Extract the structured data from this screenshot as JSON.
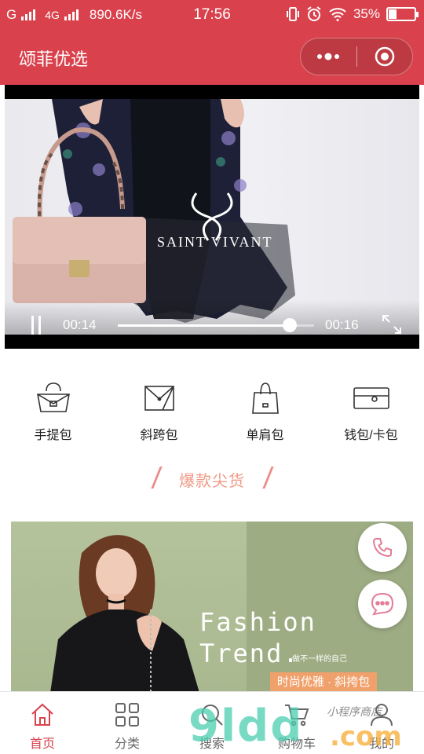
{
  "status_bar": {
    "left_text": "G",
    "network": "4G",
    "speed": "890.6K/s",
    "time": "17:56",
    "battery": "35%",
    "battery_level": 0.35
  },
  "nav": {
    "title": "颂菲优选",
    "more_icon": "more-dots-icon",
    "close_icon": "target-circle-icon"
  },
  "video": {
    "brand_text": "SAINT VIVANT",
    "current_time": "00:14",
    "duration": "00:16",
    "progress": 0.875
  },
  "categories": [
    {
      "label": "手提包",
      "icon": "handbag-icon"
    },
    {
      "label": "斜跨包",
      "icon": "crossbody-bag-icon"
    },
    {
      "label": "单肩包",
      "icon": "shoulder-bag-icon"
    },
    {
      "label": "钱包/卡包",
      "icon": "wallet-icon"
    }
  ],
  "section": {
    "hot_title": "爆款尖货"
  },
  "banner": {
    "line1": "Fashion",
    "line2": "Trend.",
    "subtitle": "做不一样的自己",
    "tag": "时尚优雅 · 斜挎包"
  },
  "tabs": [
    {
      "label": "首页",
      "icon": "home-icon",
      "active": true
    },
    {
      "label": "分类",
      "icon": "grid-icon",
      "active": false
    },
    {
      "label": "搜索",
      "icon": "search-icon",
      "active": false
    },
    {
      "label": "购物车",
      "icon": "cart-icon",
      "active": false
    },
    {
      "label": "我的",
      "icon": "user-icon",
      "active": false
    }
  ],
  "watermark": {
    "main": "9ldd",
    "suffix": ".com",
    "sub": "小程序商店"
  },
  "colors": {
    "brand_red": "#d9424d",
    "accent_salmon": "#ef9a86",
    "tag_orange": "#f0a06a"
  }
}
